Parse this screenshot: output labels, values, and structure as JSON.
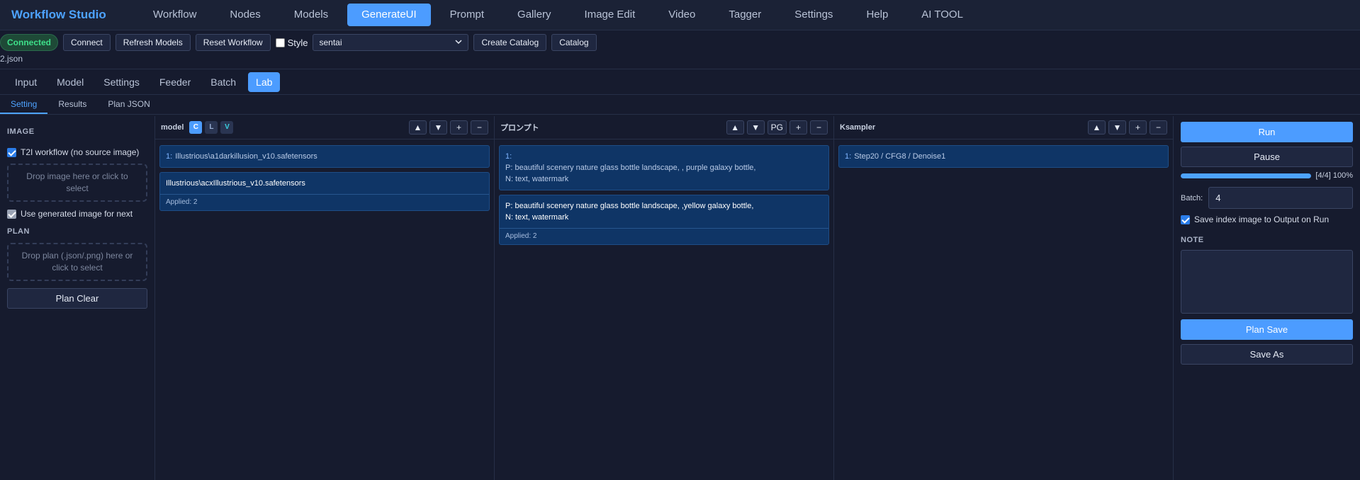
{
  "app": {
    "title": "Workflow Studio"
  },
  "nav": {
    "items": [
      "Workflow",
      "Nodes",
      "Models",
      "GenerateUI",
      "Prompt",
      "Gallery",
      "Image Edit",
      "Video",
      "Tagger",
      "Settings",
      "Help",
      "AI TOOL"
    ],
    "active": "GenerateUI"
  },
  "toolbar": {
    "status": "Connected",
    "connect": "Connect",
    "refresh_models": "Refresh Models",
    "reset_workflow": "Reset Workflow",
    "style_label": "Style",
    "style_checked": false,
    "select_value": "sentai",
    "create_catalog": "Create Catalog",
    "catalog": "Catalog",
    "filename": "2.json"
  },
  "subtabs": {
    "items": [
      "Input",
      "Model",
      "Settings",
      "Feeder",
      "Batch",
      "Lab"
    ],
    "active": "Lab"
  },
  "sectabs": {
    "items": [
      "Setting",
      "Results",
      "Plan JSON"
    ],
    "active": "Setting"
  },
  "left": {
    "image_head": "IMAGE",
    "t2i_label": "T2I workflow (no source image)",
    "t2i_checked": true,
    "image_drop": "Drop image here or click to select",
    "use_generated_label": "Use generated image for next",
    "use_generated_checked": true,
    "plan_head": "PLAN",
    "plan_drop": "Drop plan (.json/.png) here or click to select",
    "plan_clear": "Plan Clear"
  },
  "columns": {
    "model": {
      "name": "model",
      "chips": [
        "C",
        "L",
        "V"
      ],
      "controls": [
        "▲",
        "▼",
        "+",
        "−"
      ],
      "cards": [
        {
          "num": "1:",
          "text": "Illustrious\\a1darkillusion_v10.safetensors"
        },
        {
          "text": "Illustrious\\acxIllustrious_v10.safetensors",
          "applied": "Applied: 2"
        }
      ]
    },
    "prompt": {
      "name": "プロンプト",
      "controls": [
        "▲",
        "▼",
        "PG",
        "+",
        "−"
      ],
      "cards": [
        {
          "num": "1:",
          "p": "P: beautiful scenery nature glass bottle landscape, , purple galaxy bottle,",
          "n": "N: text, watermark"
        },
        {
          "p": "P: beautiful scenery nature glass bottle landscape, ,yellow galaxy bottle,",
          "n": "N: text, watermark",
          "applied": "Applied: 2"
        }
      ]
    },
    "ksampler": {
      "name": "Ksampler",
      "controls": [
        "▲",
        "▼",
        "+",
        "−"
      ],
      "cards": [
        {
          "num": "1:",
          "text": "Step20 / CFG8 / Denoise1"
        }
      ]
    }
  },
  "right": {
    "run": "Run",
    "pause": "Pause",
    "progress_text": "[4/4] 100%",
    "progress_fraction": 1.0,
    "batch_label": "Batch:",
    "batch_value": "4",
    "save_index_label": "Save index image to Output on Run",
    "save_index_checked": true,
    "note_head": "NOTE",
    "plan_save": "Plan Save",
    "save_as": "Save As"
  },
  "colors": {
    "accent": "#4c9cff",
    "connected": "#3ee08a",
    "card_bg": "#0f3566"
  }
}
